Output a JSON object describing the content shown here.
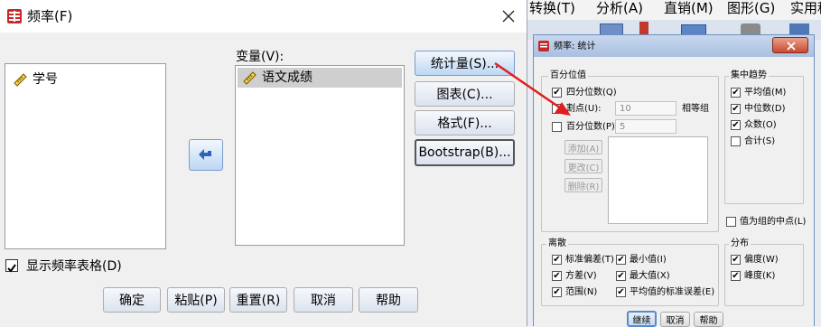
{
  "main_dialog": {
    "title": "频率(F)",
    "source_vars": [
      "学号"
    ],
    "target_label": "变量(V):",
    "target_vars": [
      "语文成绩"
    ],
    "side_buttons": [
      "统计量(S)...",
      "图表(C)...",
      "格式(F)...",
      "Bootstrap(B)..."
    ],
    "show_table_label": "显示频率表格(D)",
    "show_table_checked": true,
    "bottom_buttons": [
      "确定",
      "粘贴(P)",
      "重置(R)",
      "取消",
      "帮助"
    ]
  },
  "bg_menu": [
    "转换(T)",
    "分析(A)",
    "直销(M)",
    "图形(G)",
    "实用程"
  ],
  "stats_dialog": {
    "title": "频率: 统计",
    "percentile_group": "百分位值",
    "quartiles_label": "四分位数(Q)",
    "cut_label": "割点(U):",
    "cut_value": "10",
    "cut_suffix": "相等组",
    "percentile_label": "百分位数(P):",
    "percentile_value": "5",
    "list_buttons": [
      "添加(A)",
      "更改(C)",
      "删除(R)"
    ],
    "central_group": "集中趋势",
    "central_items": [
      {
        "label": "平均值(M)",
        "checked": "✔"
      },
      {
        "label": "中位数(D)",
        "checked": "✔"
      },
      {
        "label": "众数(O)",
        "checked": "✔"
      },
      {
        "label": "合计(S)",
        "checked": ""
      }
    ],
    "midpoint_label": "值为组的中点(L)",
    "dispersion_group": "离散",
    "dispersion_items": [
      "标准偏差(T)",
      "最小值(I)",
      "方差(V)",
      "最大值(X)",
      "范围(N)",
      "平均值的标准误差(E)"
    ],
    "distribution_group": "分布",
    "distribution_items": [
      "偏度(W)",
      "峰度(K)"
    ],
    "footer_buttons": [
      "继续",
      "取消",
      "帮助"
    ]
  }
}
